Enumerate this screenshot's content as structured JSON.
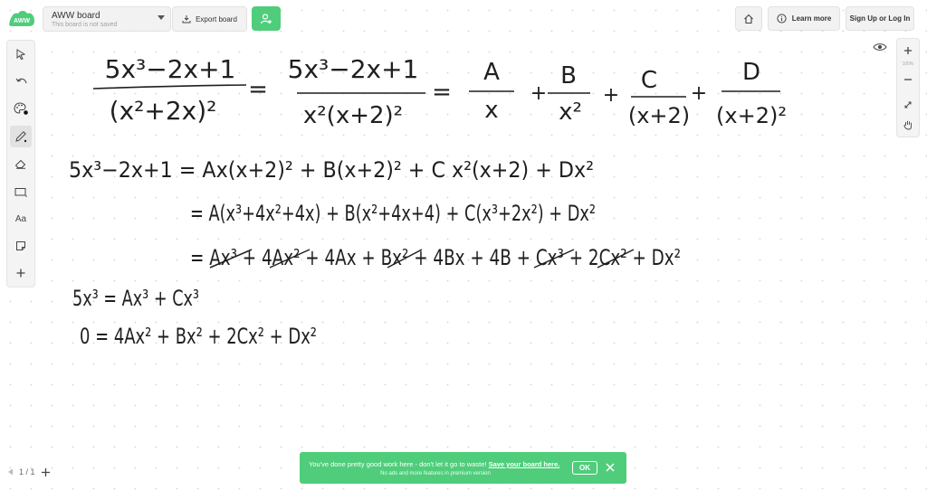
{
  "app": {
    "logo_text": "AWW",
    "board_title": "AWW board",
    "board_subtitle": "This board is not saved",
    "export_label": "Export board",
    "learn_more_label": "Learn more",
    "signup_label": "Sign Up or Log In"
  },
  "zoom": {
    "level_label": "100%"
  },
  "pager": {
    "label": "1 / 1"
  },
  "banner": {
    "message": "You've done pretty good work here - don't let it go to waste!",
    "link": "Save your board here.",
    "subtext": "No ads and more features in premium version",
    "ok_label": "OK"
  },
  "toolbar": {
    "text_tool_label": "Aa"
  },
  "whiteboard": {
    "line1_lhs_num": "5x³−2x+1",
    "line1_lhs_den": "(x²+2x)²",
    "line1_mid_num": "5x³−2x+1",
    "line1_mid_den": "x²(x+2)²",
    "frac_a_num": "A",
    "frac_a_den": "x",
    "frac_b_num": "B",
    "frac_b_den": "x²",
    "frac_c_num": "C",
    "frac_c_den": "(x+2)",
    "frac_d_num": "D",
    "frac_d_den": "(x+2)²",
    "line2": "5x³−2x+1 = Ax(x+2)² + B(x+2)² + C x²(x+2) + Dx²",
    "line3": "= A(x³+4x²+4x) + B(x²+4x+4) + C(x³+2x²) + Dx²",
    "line4": "= Ax³ + 4Ax² + 4Ax + Bx² + 4Bx + 4B + Cx³ + 2Cx² + Dx²",
    "line5": "5x³ = Ax³ + Cx³",
    "line6": "0 = 4Ax² + Bx² + 2Cx² + Dx²",
    "ink_color": "#1f1f1f"
  },
  "colors": {
    "accent": "#4fcd7b",
    "toolbar_bg": "#f4f4f4"
  },
  "icons": [
    "cursor-icon",
    "undo-icon",
    "palette-icon",
    "pencil-icon",
    "eraser-icon",
    "rectangle-icon",
    "sticky-note-icon",
    "plus-icon",
    "eye-icon",
    "home-icon",
    "info-icon",
    "export-icon",
    "add-user-icon",
    "pan-hand-icon",
    "fit-icon"
  ]
}
